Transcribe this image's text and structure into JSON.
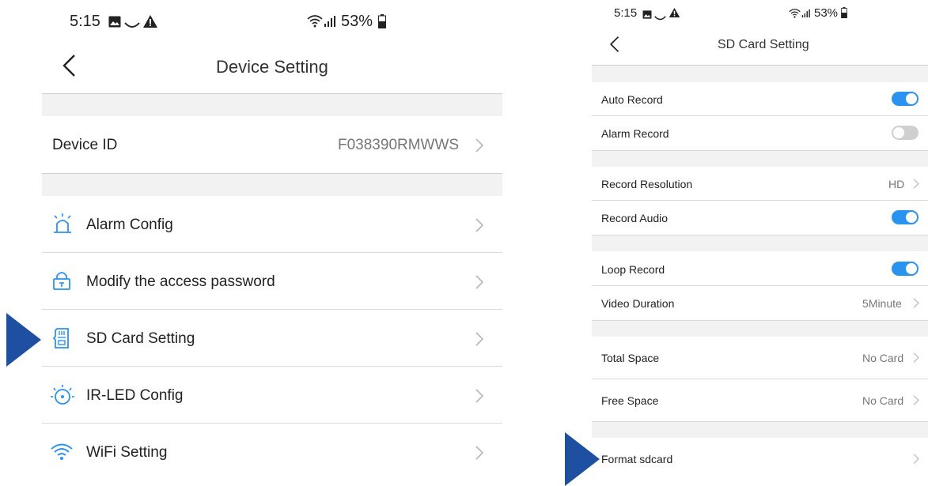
{
  "left": {
    "status": {
      "time": "5:15",
      "battery": "53%"
    },
    "title": "Device Setting",
    "device_id_label": "Device ID",
    "device_id_value": "F038390RMWWS",
    "menu": [
      {
        "label": "Alarm Config",
        "icon": "alarm-icon"
      },
      {
        "label": "Modify the access password",
        "icon": "lock-icon"
      },
      {
        "label": "SD Card Setting",
        "icon": "sd-card-icon"
      },
      {
        "label": "IR-LED Config",
        "icon": "ir-led-icon"
      },
      {
        "label": "WiFi Setting",
        "icon": "wifi-icon"
      }
    ]
  },
  "right": {
    "status": {
      "time": "5:15",
      "battery": "53%"
    },
    "title": "SD Card Setting",
    "rows": [
      {
        "label": "Auto Record",
        "toggle": "on"
      },
      {
        "label": "Alarm Record",
        "toggle": "off"
      },
      {
        "label": "Record Resolution",
        "value": "HD"
      },
      {
        "label": "Record Audio",
        "toggle": "on"
      },
      {
        "label": "Loop Record",
        "toggle": "on"
      },
      {
        "label": "Video Duration",
        "value": "5Minute"
      },
      {
        "label": "Total Space",
        "value": "No Card"
      },
      {
        "label": "Free Space",
        "value": "No Card"
      },
      {
        "label": "Format sdcard"
      }
    ]
  },
  "colors": {
    "accent": "#2a93f0",
    "pointer": "#1f4fa0"
  }
}
